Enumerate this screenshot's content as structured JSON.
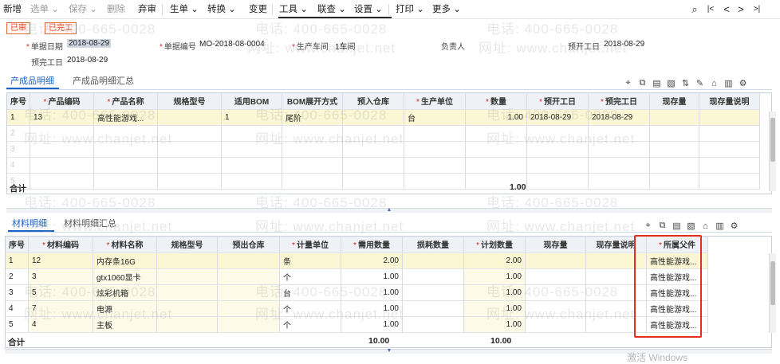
{
  "toolbar": {
    "items": [
      {
        "label": "新增",
        "disabled": false
      },
      {
        "label": "选单 ⌄",
        "disabled": true
      },
      {
        "label": "保存 ⌄",
        "disabled": true
      },
      {
        "label": "删除",
        "disabled": true
      },
      {
        "label": "弃审",
        "disabled": false
      },
      {
        "label": "生单 ⌄",
        "disabled": false
      },
      {
        "label": "转换 ⌄",
        "disabled": false
      },
      {
        "label": "变更",
        "disabled": false
      },
      {
        "label": "工具 ⌄",
        "disabled": false
      },
      {
        "label": "联查 ⌄",
        "disabled": false
      },
      {
        "label": "设置 ⌄",
        "disabled": false
      },
      {
        "label": "打印 ⌄",
        "disabled": false
      },
      {
        "label": "更多 ⌄",
        "disabled": false
      }
    ],
    "nav": [
      "⌕",
      "|<",
      "<",
      ">",
      ">|"
    ]
  },
  "status_badges": [
    "已审",
    "已完工"
  ],
  "header": {
    "doc_date_label": "单据日期",
    "doc_date": "2018-08-29",
    "doc_no_label": "单据编号",
    "doc_no": "MO-2018-08-0004",
    "workshop_label": "生产车间",
    "workshop": "1车间",
    "owner_label": "负责人",
    "owner": "",
    "start_label": "预开工日",
    "start": "2018-08-29",
    "finish_label": "预完工日",
    "finish": "2018-08-29"
  },
  "product_tabs": [
    "产成品明细",
    "产成品明细汇总"
  ],
  "product_table": {
    "columns": [
      "序号",
      "产品编码",
      "产品名称",
      "规格型号",
      "适用BOM",
      "BOM展开方式",
      "预入仓库",
      "生产单位",
      "数量",
      "预开工日",
      "预完工日",
      "现存量",
      "现存量说明"
    ],
    "required": [
      false,
      true,
      true,
      false,
      false,
      false,
      false,
      true,
      true,
      true,
      true,
      false,
      false
    ],
    "rows": [
      [
        "1",
        "13",
        "高性能游戏...",
        "",
        "1",
        "尾阶",
        "",
        "台",
        "1.00",
        "2018-08-29",
        "2018-08-29",
        "",
        ""
      ],
      [
        "2",
        "",
        "",
        "",
        "",
        "",
        "",
        "",
        "",
        "",
        "",
        "",
        ""
      ],
      [
        "3",
        "",
        "",
        "",
        "",
        "",
        "",
        "",
        "",
        "",
        "",
        "",
        ""
      ],
      [
        "4",
        "",
        "",
        "",
        "",
        "",
        "",
        "",
        "",
        "",
        "",
        "",
        ""
      ],
      [
        "5",
        "",
        "",
        "",
        "",
        "",
        "",
        "",
        "",
        "",
        "",
        "",
        ""
      ]
    ],
    "total_label": "合计",
    "total_qty": "1.00"
  },
  "material_tabs": [
    "材料明细",
    "材料明细汇总"
  ],
  "material_table": {
    "columns": [
      "序号",
      "材料编码",
      "材料名称",
      "规格型号",
      "预出仓库",
      "计量单位",
      "需用数量",
      "损耗数量",
      "计划数量",
      "现存量",
      "现存量说明",
      "所属父件"
    ],
    "required": [
      false,
      true,
      true,
      false,
      false,
      true,
      true,
      false,
      true,
      false,
      false,
      true
    ],
    "rows": [
      [
        "1",
        "12",
        "内存条16G",
        "",
        "",
        "条",
        "2.00",
        "",
        "2.00",
        "",
        "",
        "高性能游戏..."
      ],
      [
        "2",
        "3",
        "gtx1060显卡",
        "",
        "",
        "个",
        "1.00",
        "",
        "1.00",
        "",
        "",
        "高性能游戏..."
      ],
      [
        "3",
        "5",
        "炫彩机箱",
        "",
        "",
        "台",
        "1.00",
        "",
        "1.00",
        "",
        "",
        "高性能游戏..."
      ],
      [
        "4",
        "7",
        "电源",
        "",
        "",
        "个",
        "1.00",
        "",
        "1.00",
        "",
        "",
        "高性能游戏..."
      ],
      [
        "5",
        "4",
        "主板",
        "",
        "",
        "个",
        "1.00",
        "",
        "1.00",
        "",
        "",
        "高性能游戏..."
      ]
    ],
    "total_label": "合计",
    "total_need": "10.00",
    "total_plan": "10.00"
  },
  "watermarks": {
    "phone": "电话: 400-665-0028",
    "site": "网址: www.chanjet.net"
  },
  "os_notice": "激活 Windows",
  "colors": {
    "accent": "#1b63c4",
    "highlight_row": "#fbf6d3",
    "badge_border": "#e06b3a",
    "red_box": "#e03020"
  }
}
